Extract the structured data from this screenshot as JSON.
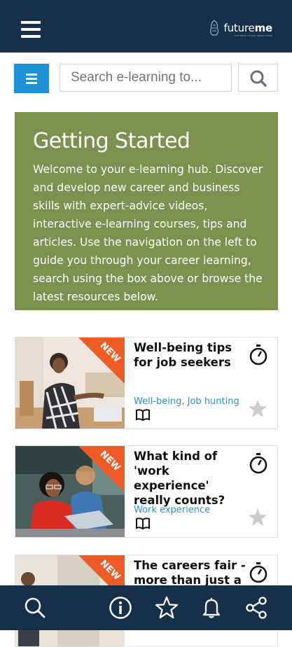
{
  "header": {
    "logo_text_light": "future",
    "logo_text_bold": "me",
    "logo_tagline": "the future of your career starts"
  },
  "search": {
    "placeholder": "Search e-learning to..."
  },
  "hero": {
    "title": "Getting Started",
    "body": "Welcome to your e-learning hub. Discover and develop new career and business skills with expert-advice videos, interactive e-learning courses, tips and articles. Use the navigation on the left to guide you through your career learning, search using the box above or browse the latest resources below."
  },
  "cards": [
    {
      "badge": "NEW",
      "title": "Well-being tips for job seekers",
      "tags": "Well-being, Job hunting"
    },
    {
      "badge": "NEW",
      "title": "What kind of 'work experience' really counts?",
      "tags": "Work experience"
    },
    {
      "badge": "NEW",
      "title": "The careers fair - more than just a",
      "tags": ""
    }
  ],
  "colors": {
    "header_bg": "#16304a",
    "accent_blue": "#1e92d6",
    "hero_green": "#79924e",
    "new_badge": "#ef5b25",
    "tag_blue": "#2b90c7"
  },
  "bottom_nav": [
    {
      "icon": "search-icon"
    },
    {
      "icon": "info-icon"
    },
    {
      "icon": "star-icon"
    },
    {
      "icon": "bell-icon"
    },
    {
      "icon": "share-icon"
    }
  ]
}
